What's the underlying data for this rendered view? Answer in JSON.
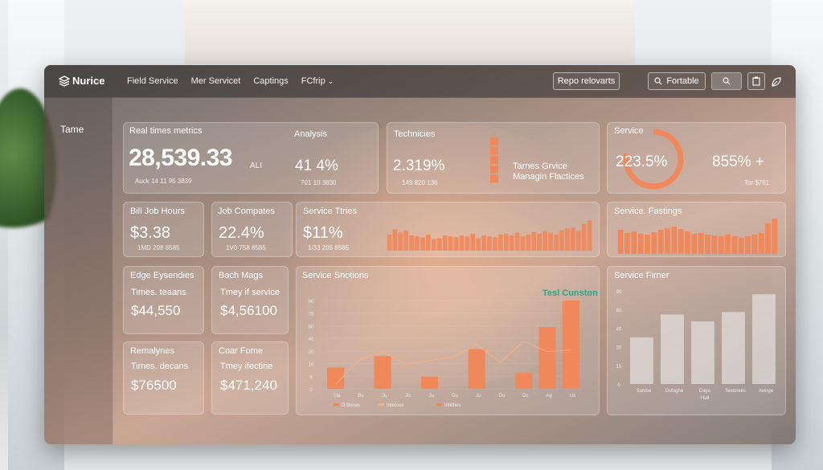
{
  "app": {
    "logo": "Nurice"
  },
  "nav": [
    "Field Service",
    "Mer Servicet",
    "Captings",
    "FCfrip"
  ],
  "toolbar": {
    "reports_label": "Repo relovarts",
    "search_label": "Fortable"
  },
  "sidebar": {
    "items": [
      "Tame"
    ]
  },
  "cards": {
    "realtime": {
      "title": "Real times metrics",
      "value": "28,539.33",
      "value_suffix": "ALI",
      "sub": "Auck 14 11 95 3839",
      "analysis_title": "Analysis",
      "analysis_value": "41 4%",
      "analysis_sub": "701 10 3830"
    },
    "technicians": {
      "title": "Technicies",
      "value": "2.319%",
      "sub": "149 820 136",
      "note_line1": "Tarnes Grvice",
      "note_line2": "Managin Flactices",
      "bars": [
        35,
        55,
        75,
        95,
        115
      ]
    },
    "service": {
      "title": "Service",
      "value": "223.5%",
      "right_value": "855% +",
      "right_sub": "Tor $761",
      "gauge_fraction": 0.78
    },
    "bill": {
      "title": "Bill Job Hours",
      "value": "$3.38",
      "sub": "1MD 208 8585"
    },
    "job": {
      "title": "Job Compates",
      "value": "22.4%",
      "sub": "1V0 758 8585"
    },
    "service_trend": {
      "title": "Service Ttries",
      "value": "$11%",
      "sub": "1/33 205 8585",
      "bars": [
        18,
        24,
        20,
        22,
        17,
        16,
        15,
        18,
        13,
        14,
        17,
        16,
        15,
        17,
        16,
        19,
        14,
        17,
        16,
        15,
        18,
        19,
        17,
        20,
        16,
        18,
        21,
        19,
        22,
        20,
        18,
        23,
        25,
        26,
        22,
        30,
        34
      ]
    },
    "ratings": {
      "title": "Service. Fastings",
      "bars": [
        30,
        26,
        28,
        25,
        24,
        27,
        30,
        32,
        34,
        31,
        28,
        25,
        26,
        24,
        23,
        22,
        24,
        22,
        20,
        22,
        24,
        26,
        38,
        44
      ]
    },
    "edge": {
      "title": "Edge Eysendies",
      "label": "Times. teaans",
      "value": "$44,550"
    },
    "bach": {
      "title": "Bach Mags",
      "label": "Tmey if service",
      "value": "$4,56100"
    },
    "remaly": {
      "title": "Remalynes",
      "label": "Times. decans",
      "value": "$76500"
    },
    "coar": {
      "title": "Coar Fome",
      "label": "Tmey ifectine",
      "value": "$471,240"
    }
  },
  "chart_data": [
    {
      "type": "bar",
      "title": "Service Snotions",
      "annotation": "Tesl Cunston",
      "categories": [
        "Ua",
        "Bu",
        "Ju",
        "Jis",
        "Ju",
        "Du",
        "Ju",
        "Do",
        "Dc",
        "Ag",
        "Us"
      ],
      "values": [
        24,
        0,
        37,
        0,
        14,
        0,
        45,
        0,
        18,
        70,
        100
      ],
      "line_values": [
        5,
        33,
        42,
        28,
        32,
        36,
        50,
        30,
        54,
        42,
        44
      ],
      "ylim": [
        0,
        100
      ],
      "yticks": [
        "0",
        "8",
        "10",
        "20",
        "40",
        "60",
        "70",
        "90"
      ],
      "legend": [
        "D Bonas",
        "Intetoes",
        "Intlifties"
      ],
      "bar_color": "#f0885a",
      "line_color": "#f4b088"
    },
    {
      "type": "bar",
      "title": "Service Firner",
      "categories": [
        "Sanise",
        "Dsfoghe",
        "Daya Hall",
        "Textorees",
        "Avinge"
      ],
      "values": [
        55,
        82,
        74,
        85,
        106
      ],
      "ylim": [
        0,
        110
      ],
      "yticks": [
        "0",
        "15",
        "30",
        "45",
        "60",
        "90"
      ],
      "bar_color": "#f2f2f2"
    }
  ],
  "colors": {
    "accent": "#f0885a",
    "teal": "#2aa58a"
  }
}
